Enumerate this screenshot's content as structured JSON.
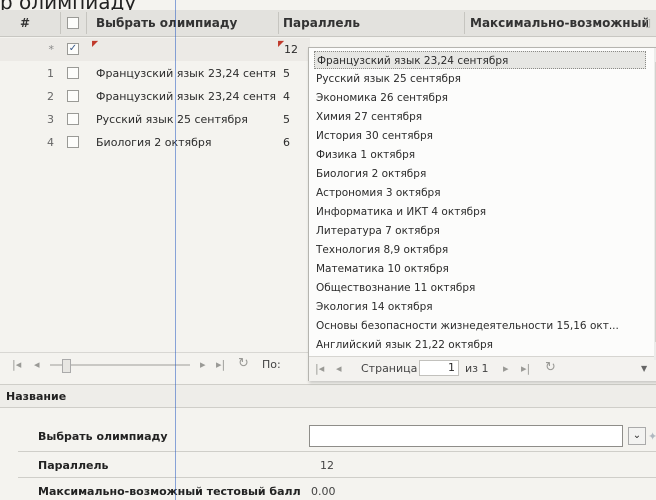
{
  "page": {
    "title": "р олимпиаду"
  },
  "grid": {
    "columns": {
      "number": "#",
      "olympiad": "Выбрать олимпиаду",
      "parallel": "Параллель",
      "max_score": "Максимально-возможный..."
    },
    "edit_row": {
      "marker": "*",
      "parallel": "12"
    },
    "rows": [
      {
        "num": "1",
        "name": "Французский язык 23,24 сентя",
        "parallel": "5"
      },
      {
        "num": "2",
        "name": "Французский язык 23,24 сентя",
        "parallel": "4"
      },
      {
        "num": "3",
        "name": "Русский язык 25 сентября",
        "parallel": "5"
      },
      {
        "num": "4",
        "name": "Биология 2 октября",
        "parallel": "6"
      }
    ],
    "pager_label": "По:"
  },
  "dropdown": {
    "items": [
      "Французский язык 23,24 сентября",
      "Русский язык 25 сентября",
      "Экономика 26 сентября",
      "Химия 27 сентября",
      "История 30 сентября",
      "Физика 1 октября",
      "Биология 2 октября",
      "Астрономия 3 октября",
      "Информатика и ИКТ 4 октября",
      "Литература 7 октября",
      "Технология 8,9 октября",
      "Математика 10 октября",
      "Обществознание 11 октября",
      "Экология 14 октября",
      "Основы безопасности жизнедеятельности 15,16 окт...",
      "Английский язык 21,22 октября"
    ],
    "pager": {
      "page_label": "Страница",
      "page_value": "1",
      "of_label": "из 1"
    }
  },
  "form": {
    "section_title": "Название",
    "olympiad_label": "Выбрать олимпиаду",
    "olympiad_value": "",
    "parallel_label": "Параллель",
    "parallel_value": "12",
    "max_score_label": "Максимально-возможный тестовый балл",
    "max_score_value": "0.00"
  }
}
